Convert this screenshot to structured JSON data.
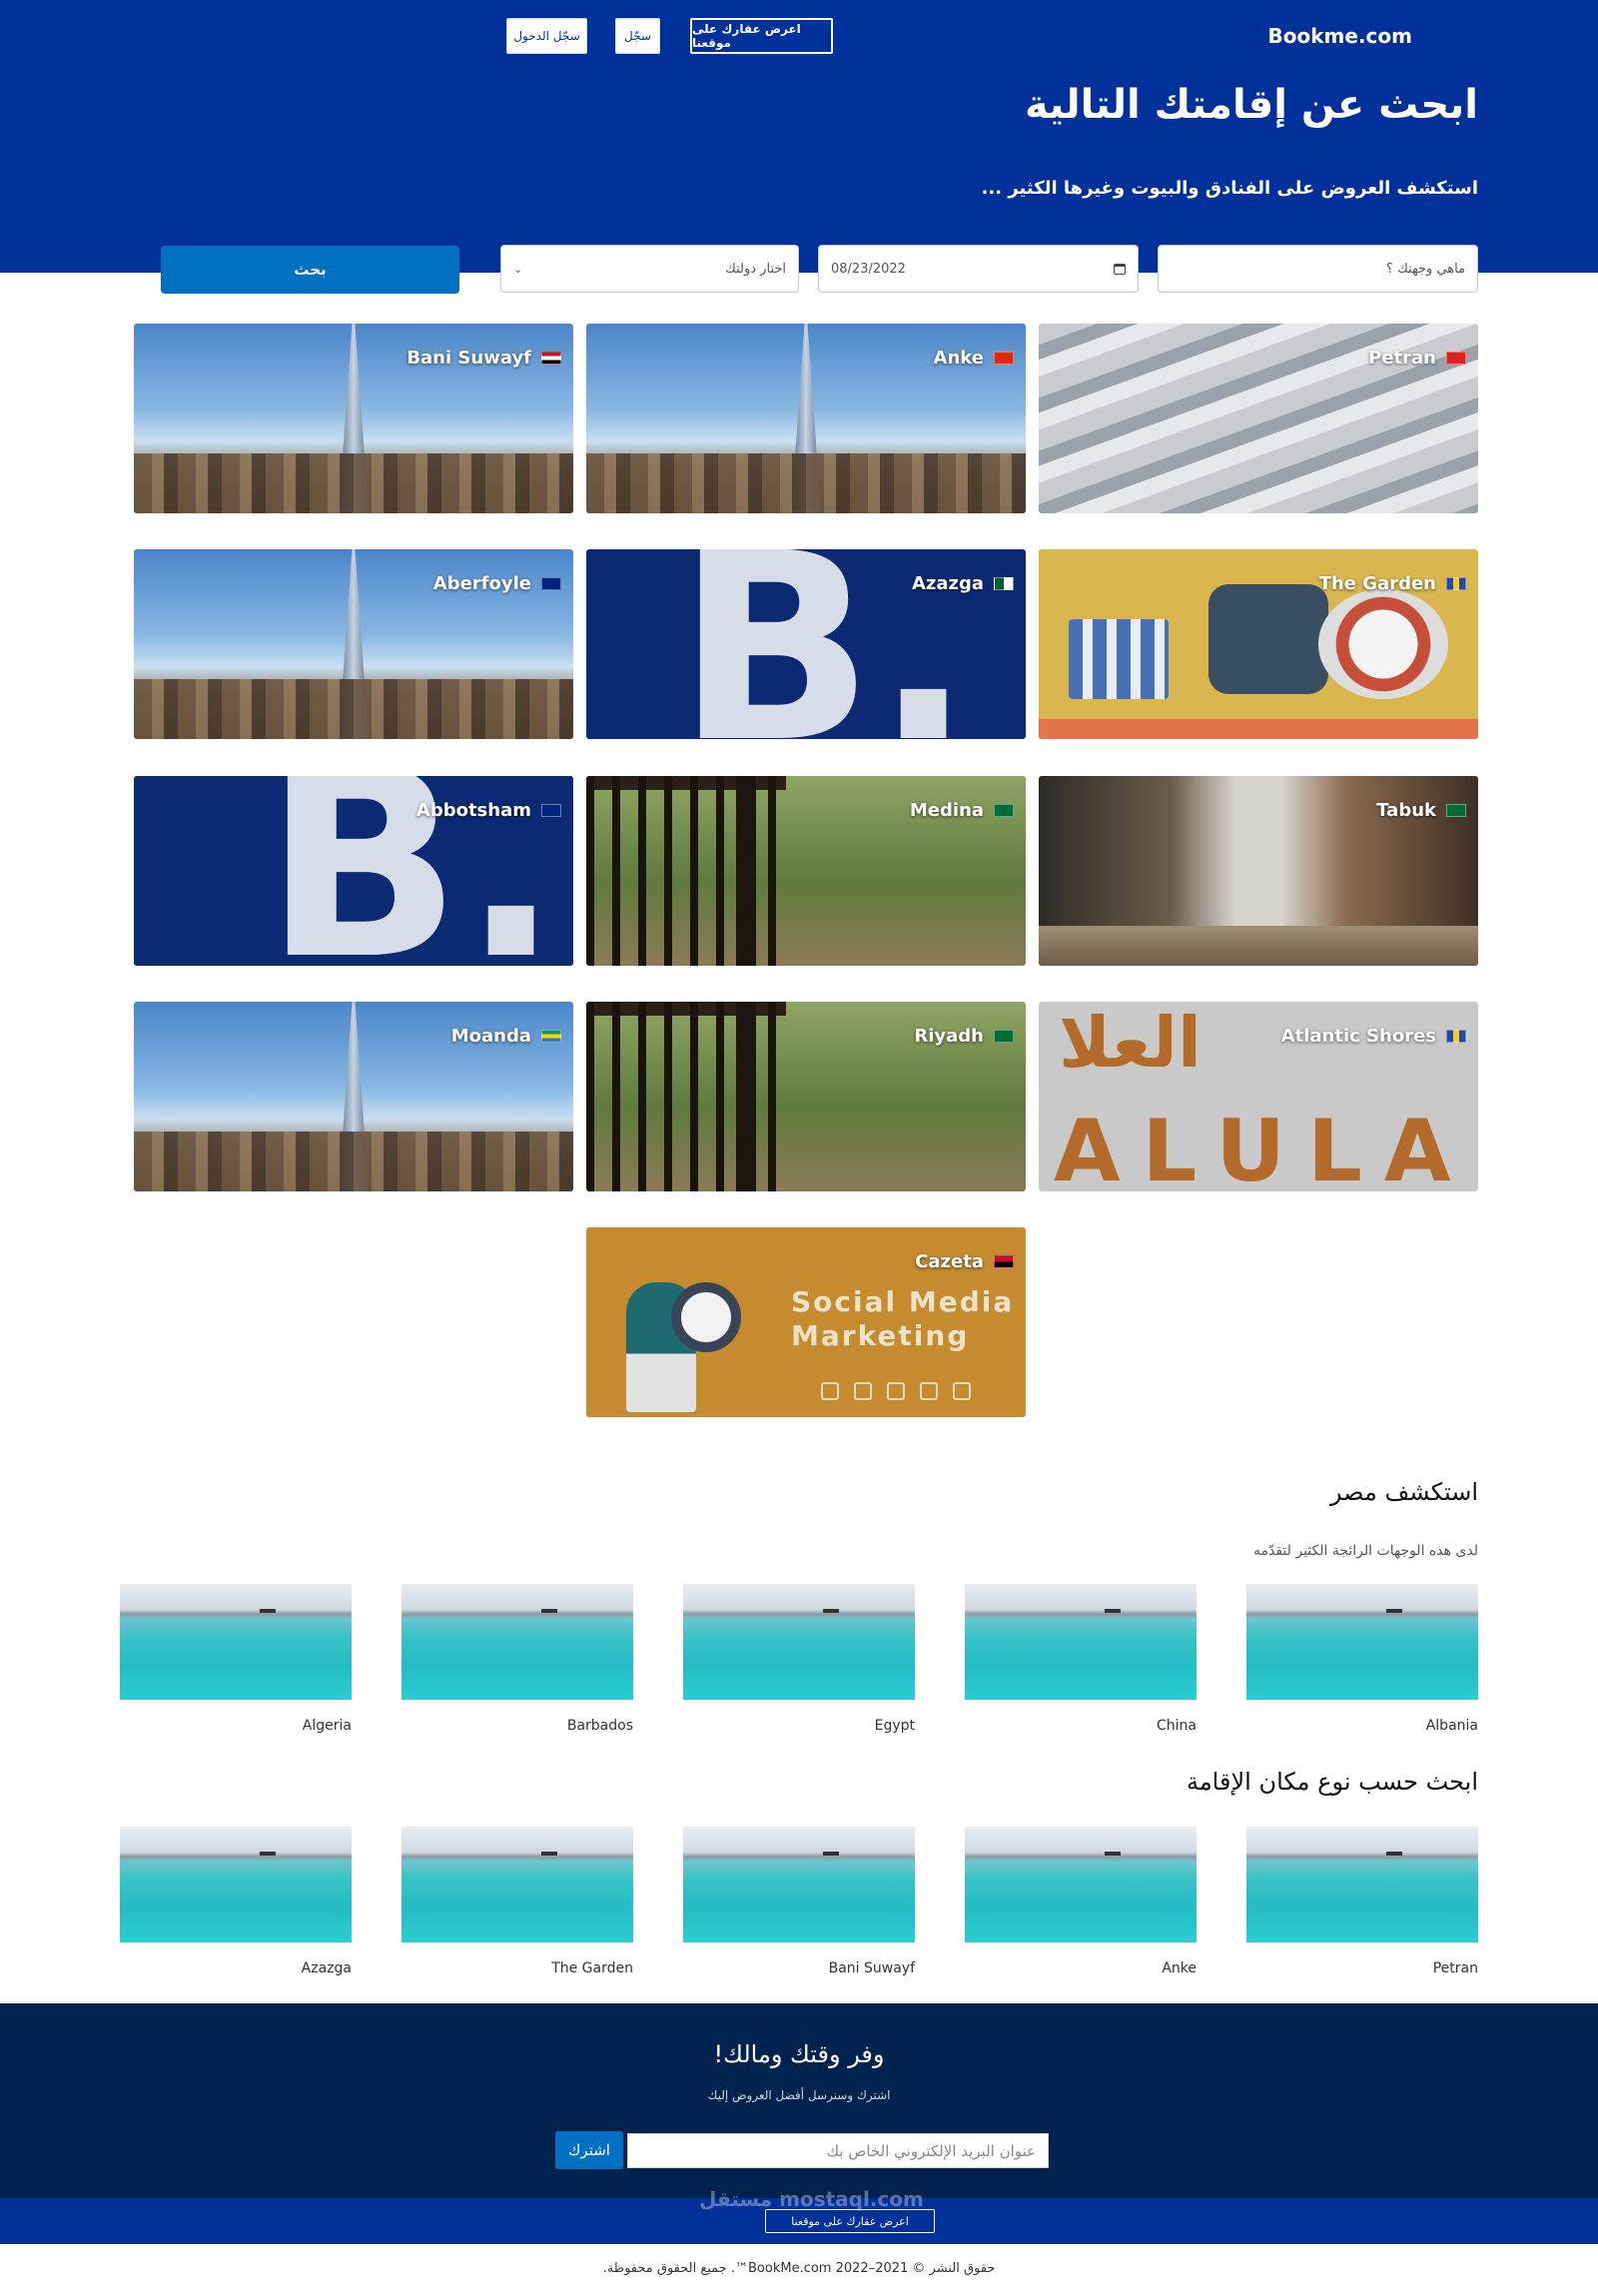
{
  "header": {
    "brand": "Bookme.com",
    "list_property": "اعرض عقارك على موقعنا",
    "register": "سجّل",
    "login": "سجّل الدخول",
    "title": "ابحث عن إقامتك التالية",
    "subtitle": "استكشف العروض على الفنادق والبيوت وغيرها الكثير ..."
  },
  "search": {
    "destination_placeholder": "ماهي وجهتك ؟",
    "date": "08/23/2022",
    "country_select": "اختار دولتك",
    "button": "بحث"
  },
  "destinations": [
    {
      "name": "Petran",
      "flag": "#e0201c"
    },
    {
      "name": "Anke",
      "flag": "#de2910"
    },
    {
      "name": "Bani Suwayf",
      "flag": "#ce1126"
    },
    {
      "name": "The Garden",
      "flag": "#1f4aa8"
    },
    {
      "name": "Azazga",
      "flag": "#006233"
    },
    {
      "name": "Aberfoyle",
      "flag": "#00247d"
    },
    {
      "name": "Tabuk",
      "flag": "#006c35"
    },
    {
      "name": "Medina",
      "flag": "#006c35"
    },
    {
      "name": "Abbotsham",
      "flag": "#00247d"
    },
    {
      "name": "Atlantic Shores",
      "flag": "#1f4aa8"
    },
    {
      "name": "Riyadh",
      "flag": "#006c35"
    },
    {
      "name": "Moanda",
      "flag": "#009e60"
    },
    {
      "name": "Cazeta",
      "flag": "#cc092f"
    }
  ],
  "social_media_card": {
    "line1": "Social Media",
    "line2": "Marketing"
  },
  "explore": {
    "title": "استكشف مصر",
    "subtitle": "لدى هذه الوجهات الرائجة الكثير لتقدّمه",
    "items": [
      "Albania",
      "China",
      "Egypt",
      "Barbados",
      "Algeria"
    ]
  },
  "by_type": {
    "title": "ابحث حسب نوع مكان الإقامة",
    "items": [
      "Petran",
      "Anke",
      "Bani Suwayf",
      "The Garden",
      "Azazga"
    ]
  },
  "newsletter": {
    "title": "وفر وقتك ومالك!",
    "subtitle": "اشترك وسنرسل أفضل العروض إليك",
    "email_placeholder": "عنوان البريد الإلكتروني الخاص بك",
    "subscribe": "اشترك"
  },
  "footer": {
    "list_property": "اعرض عقارك على موقعنا",
    "watermark": "مستقل mostaql.com",
    "copyright": "حقوق النشر © 2021–2022 BookMe.com™. جميع الحقوق محفوظة."
  },
  "colors": {
    "primary": "#003099",
    "accent": "#0071c2",
    "footer_dark": "#00224f"
  }
}
